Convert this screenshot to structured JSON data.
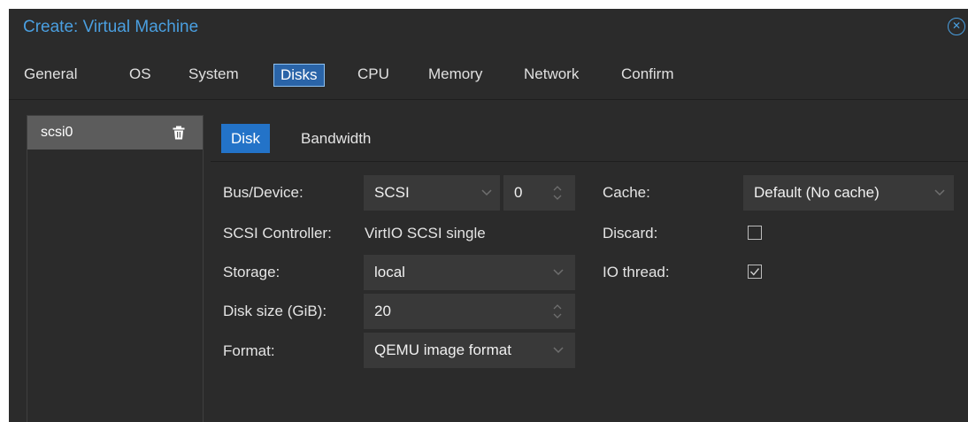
{
  "window": {
    "title": "Create: Virtual Machine",
    "close_icon": "close-circle-icon"
  },
  "wizard_tabs": [
    {
      "label": "General",
      "active": false
    },
    {
      "label": "OS",
      "active": false
    },
    {
      "label": "System",
      "active": false
    },
    {
      "label": "Disks",
      "active": true
    },
    {
      "label": "CPU",
      "active": false
    },
    {
      "label": "Memory",
      "active": false
    },
    {
      "label": "Network",
      "active": false
    },
    {
      "label": "Confirm",
      "active": false
    }
  ],
  "disk_list": {
    "items": [
      {
        "label": "scsi0",
        "selected": true,
        "icon": "trash-icon"
      }
    ]
  },
  "subtabs": [
    {
      "label": "Disk",
      "active": true
    },
    {
      "label": "Bandwidth",
      "active": false
    }
  ],
  "form": {
    "bus_device": {
      "label": "Bus/Device:",
      "bus": "SCSI",
      "device": "0"
    },
    "scsi_controller": {
      "label": "SCSI Controller:",
      "value": "VirtIO SCSI single"
    },
    "storage": {
      "label": "Storage:",
      "value": "local"
    },
    "disk_size": {
      "label": "Disk size (GiB):",
      "value": "20"
    },
    "format": {
      "label": "Format:",
      "value": "QEMU image format"
    },
    "cache": {
      "label": "Cache:",
      "value": "Default (No cache)"
    },
    "discard": {
      "label": "Discard:",
      "checked": false
    },
    "io_thread": {
      "label": "IO thread:",
      "checked": true
    }
  },
  "colors": {
    "accent": "#4a9fe0",
    "active_tab_bg": "#2373c8",
    "background": "#2b2b2b",
    "field_bg": "#393939"
  }
}
